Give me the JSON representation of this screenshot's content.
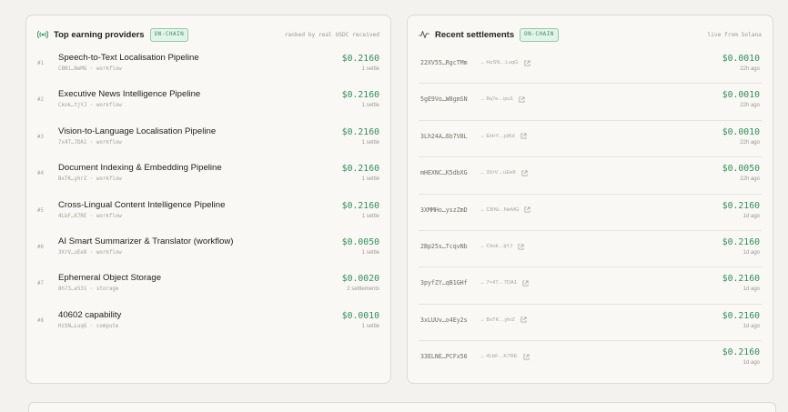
{
  "providers": {
    "title": "Top earning providers",
    "badge": "ON-CHAIN",
    "note": "ranked by real USDC received",
    "items": [
      {
        "rank": "#1",
        "name": "Speech-to-Text Localisation Pipeline",
        "sub": "CBNi…NeMG · workflow",
        "amount": "$0.2160",
        "unit": "1 settle"
      },
      {
        "rank": "#2",
        "name": "Executive News Intelligence Pipeline",
        "sub": "Ckok…tjYJ · workflow",
        "amount": "$0.2160",
        "unit": "1 settle"
      },
      {
        "rank": "#3",
        "name": "Vision-to-Language Localisation Pipeline",
        "sub": "7x4T…7DA1 · workflow",
        "amount": "$0.2160",
        "unit": "1 settle"
      },
      {
        "rank": "#4",
        "name": "Document Indexing & Embedding Pipeline",
        "sub": "BxTK…yhrZ · workflow",
        "amount": "$0.2160",
        "unit": "1 settle"
      },
      {
        "rank": "#5",
        "name": "Cross-Lingual Content Intelligence Pipeline",
        "sub": "4LbF…K7RE · workflow",
        "amount": "$0.2160",
        "unit": "1 settle"
      },
      {
        "rank": "#6",
        "name": "AI Smart Summarizer & Translator (workflow)",
        "sub": "3XrV…uEe8 · workflow",
        "amount": "$0.0050",
        "unit": "1 settle"
      },
      {
        "rank": "#7",
        "name": "Ephemeral Object Storage",
        "sub": "8h73…e531 · storage",
        "amount": "$0.0020",
        "unit": "2 settlements"
      },
      {
        "rank": "#8",
        "name": "40602 capability",
        "sub": "HzSN…LuqG · compute",
        "amount": "$0.0010",
        "unit": "1 settle"
      }
    ]
  },
  "settlements": {
    "title": "Recent settlements",
    "badge": "ON-CHAIN",
    "note": "live from Solana",
    "items": [
      {
        "sig": "22XV55…RgcTMm",
        "prov": "→ HzSN…LuqG",
        "amount": "$0.0010",
        "time": "22h ago"
      },
      {
        "sig": "5gE9Vo…W8gmSN",
        "prov": "→ 8q7e…ipu1",
        "amount": "$0.0010",
        "time": "22h ago"
      },
      {
        "sig": "3Lh24A…6b7V8L",
        "prov": "→ EHrY…jdKd",
        "amount": "$0.0010",
        "time": "22h ago"
      },
      {
        "sig": "mHEXNC…K5dbXG",
        "prov": "→ 3XrV…uEe8",
        "amount": "$0.0050",
        "time": "22h ago"
      },
      {
        "sig": "3XMMHo…yszZmD",
        "prov": "→ CBNi…NeMG",
        "amount": "$0.2160",
        "time": "1d ago"
      },
      {
        "sig": "2Bp25s…TcqvNb",
        "prov": "→ Ckok…tjYJ",
        "amount": "$0.2160",
        "time": "1d ago"
      },
      {
        "sig": "3pyfZY…qB1GHf",
        "prov": "→ 7×4T…7DA1",
        "amount": "$0.2160",
        "time": "1d ago"
      },
      {
        "sig": "3xLUUv…o4Ey2s",
        "prov": "→ BxTK…yhrZ",
        "amount": "$0.2160",
        "time": "1d ago"
      },
      {
        "sig": "33ELNE…PCFx56",
        "prov": "→ 4LbF…K7RE",
        "amount": "$0.2160",
        "time": "1d ago"
      }
    ]
  },
  "colors": {
    "accent": "#2f8f5c",
    "badge_bg": "#e4f3e9",
    "muted": "#a6a49d"
  },
  "icons": {
    "providers": "broadcast-icon",
    "settlements": "activity-icon",
    "link": "external-link-icon"
  }
}
